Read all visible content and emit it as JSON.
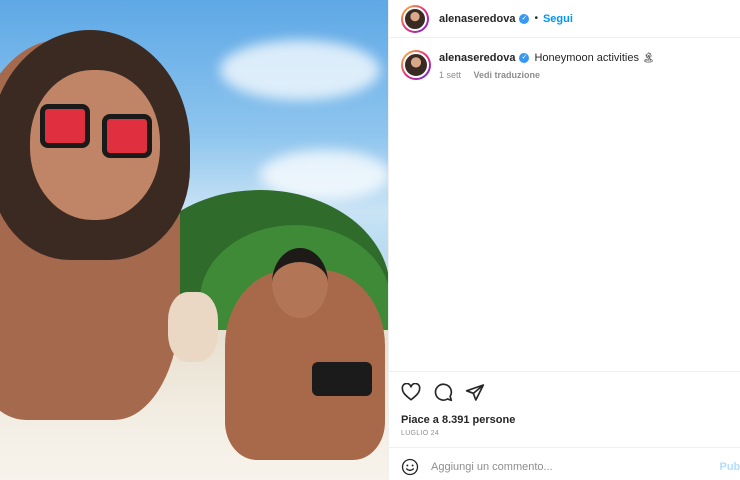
{
  "post": {
    "username": "alenaseredova",
    "follow_label": "Segui",
    "separator": "•",
    "caption_text": "Honeymoon activities",
    "caption_emoji": "🏝",
    "time_ago": "1 sett",
    "translate_label": "Vedi traduzione",
    "likes_text": "Piace a 8.391 persone",
    "date_text": "LUGLIO 24",
    "photo_alt": "Beach selfie photo"
  },
  "comment": {
    "placeholder": "Aggiungi un commento...",
    "publish_label": "Pubb"
  },
  "icons": {
    "like": "heart-icon",
    "comment": "comment-icon",
    "share": "paper-plane-icon",
    "emoji": "emoji-icon",
    "verified": "verified-badge-icon"
  },
  "colors": {
    "accent": "#0095f6",
    "verified": "#3897f0",
    "muted": "#8e8e8e"
  }
}
